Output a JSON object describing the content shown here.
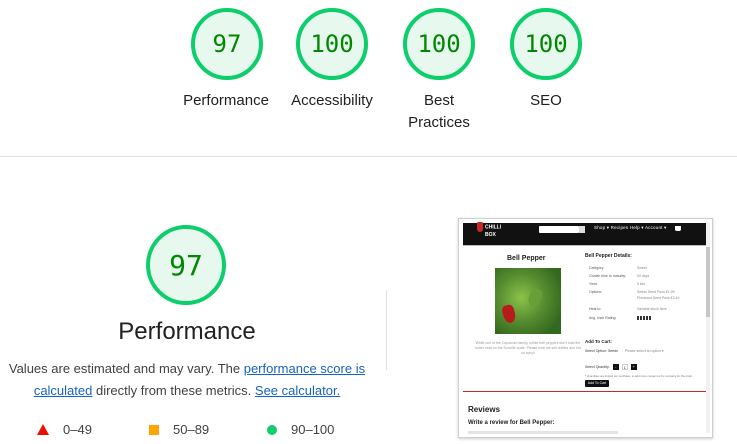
{
  "summary": {
    "categories": [
      {
        "score": "97",
        "label": "Performance"
      },
      {
        "score": "100",
        "label": "Accessibility"
      },
      {
        "score": "100",
        "label": "Best Practices"
      },
      {
        "score": "100",
        "label": "SEO"
      }
    ]
  },
  "performance": {
    "score": "97",
    "title": "Performance",
    "description_part1": "Values are estimated and may vary. The ",
    "link_score": "performance score is calculated",
    "description_part2": " directly from these metrics. ",
    "link_calculator": "See calculator."
  },
  "legend": {
    "fail": "0–49",
    "average": "50–89",
    "pass": "90–100"
  },
  "colors": {
    "pass": "#0cce6b",
    "average": "#ffa400",
    "fail": "#eb0f00",
    "score_text": "#008800",
    "link": "#1565c0"
  },
  "thumbnail": {
    "logo_line1": "CHILLI",
    "logo_line2": "BOX",
    "nav": "Shop ▾   Recipes   Help ▾   Account ▾",
    "product_title": "Bell Pepper",
    "caption": "While one of the Capsicum family, unlike bell peppers don't hold the hotter heat on the Scoville scale. Please note we sell chillies and hot so spicy!",
    "details_heading": "Bell Pepper Details:",
    "details": [
      {
        "k": "Category:",
        "v": "Sweet"
      },
      {
        "k": "Growth time to maturity:",
        "v": "90 days"
      },
      {
        "k": "Yield:",
        "v": "5 kilo"
      },
      {
        "k": "Options:",
        "v": "Seeds Seed Pack   €1.99"
      },
      {
        "k": "",
        "v": "Pheasant Seed Pack   €3.49"
      },
      {
        "k": "Heat to:",
        "v": "Variable stock here"
      },
      {
        "k": "Avg. User Rating:",
        "v": ""
      }
    ],
    "add_to_cart_heading": "Add To Cart:",
    "select_option_label": "Select Option: Seeds",
    "select_option_value": "Please select an option  ▾",
    "quantity_label": "Select Quantity:",
    "quantity_minus": "-",
    "quantity_value": "1",
    "quantity_plus": "+",
    "note": "* Quantities are limited per purchase, to add more contact us by company for the order.",
    "add_button": "Add To Cart",
    "reviews_heading": "Reviews",
    "write_review": "Write a review for Bell Pepper:"
  }
}
